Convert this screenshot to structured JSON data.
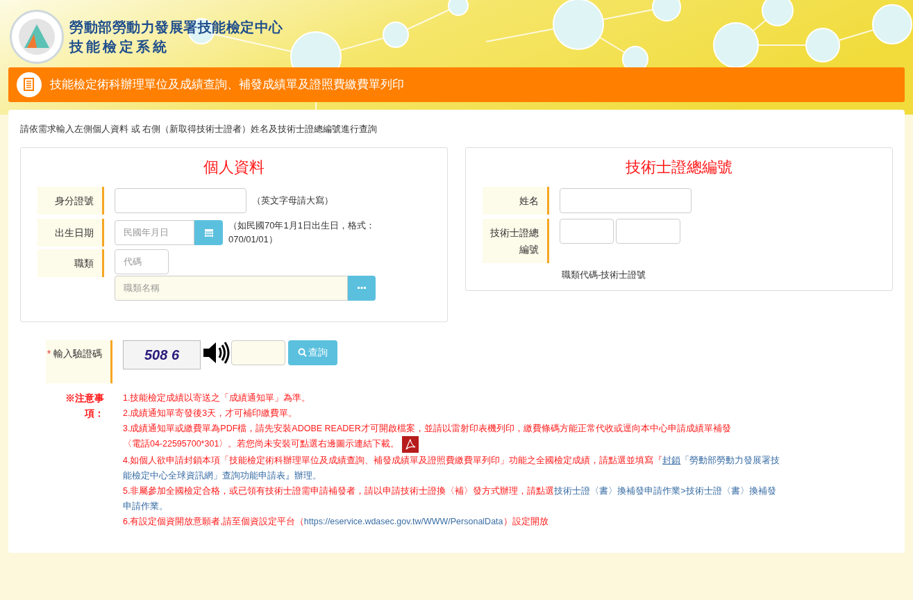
{
  "header": {
    "title": "勞動部勞動力發展署技能檢定中心",
    "subtitle": "技能檢定系統"
  },
  "page_title": "技能檢定術科辦理單位及成績查詢、補發成績單及證照費繳費單列印",
  "instruction": "請依需求輸入左側個人資料 或 右側（新取得技術士證者）姓名及技術士證總編號進行查詢",
  "personal": {
    "title": "個人資料",
    "id_label": "身分證號",
    "id_hint": "（英文字母請大寫）",
    "birth_label": "出生日期",
    "birth_placeholder": "民國年月日",
    "birth_hint": "（如民國70年1月1日出生日，格式：070/01/01）",
    "job_label": "職類",
    "job_code_placeholder": "代碼",
    "job_name_placeholder": "職類名稱"
  },
  "certificate": {
    "title": "技術士證總編號",
    "name_label": "姓名",
    "number_label": "技術士證總編號",
    "number_hint": "職類代碼-技術士證號"
  },
  "captcha": {
    "required_mark": "*",
    "label": "輸入驗證碼",
    "code": "508 6",
    "search_button": "查詢"
  },
  "notes": {
    "title": "※注意事項：",
    "items": [
      {
        "lines": [
          [
            {
              "kind": "text",
              "text": "1.技能檢定成績以寄送之「成績通知單」為準。"
            }
          ]
        ],
        "pdf_icon": false
      },
      {
        "lines": [
          [
            {
              "kind": "text",
              "text": "2.成績通知單寄發後3天，才可補印繳費單。"
            }
          ]
        ],
        "pdf_icon": false
      },
      {
        "lines": [
          [
            {
              "kind": "text",
              "text": "3.成績通知單或繳費單為PDF檔，請先安裝ADOBE READER才可開啟檔案，並請以雷射印表機列印，繳費條碼方能正常代收或逕向本中心申請成績單補發"
            }
          ],
          [
            {
              "kind": "text",
              "text": "〈電話04-22595700*301〉。若您尚未安裝可點選右邊圖示連結下載。"
            }
          ]
        ],
        "pdf_icon": true
      },
      {
        "lines": [
          [
            {
              "kind": "text",
              "text": "4.如個人欲申請封鎖本項「技能檢定術科辦理單位及成績查詢、補發成績單及證照費繳費單列印」功能之全國檢定成績，請點選並填寫『"
            },
            {
              "kind": "underlined_link",
              "text": "封鎖"
            },
            {
              "kind": "link",
              "text": "「勞動部勞動力發展署技"
            }
          ],
          [
            {
              "kind": "link",
              "text": "能檢定中心全球資訊網」查詢功能申請表』辦理。"
            }
          ]
        ],
        "pdf_icon": false
      },
      {
        "lines": [
          [
            {
              "kind": "text",
              "text": "5.非屬參加全國檢定合格，或已領有技術士證需申請補發者，請以申請技術士證換〈補〉發方式辦理，請點選"
            },
            {
              "kind": "link",
              "text": "技術士證〈書〉換補發申請作業>技術士證〈書〉換補發"
            }
          ],
          [
            {
              "kind": "link",
              "text": "申請作業。"
            }
          ]
        ],
        "pdf_icon": false
      },
      {
        "lines": [
          [
            {
              "kind": "text",
              "text": "6.有設定個資開放意願者,請至個資設定平台（"
            },
            {
              "kind": "link",
              "text": "https://eservice.wdasec.gov.tw/WWW/PersonalData"
            },
            {
              "kind": "text",
              "text": "）設定開放"
            }
          ]
        ],
        "pdf_icon": false
      }
    ]
  }
}
